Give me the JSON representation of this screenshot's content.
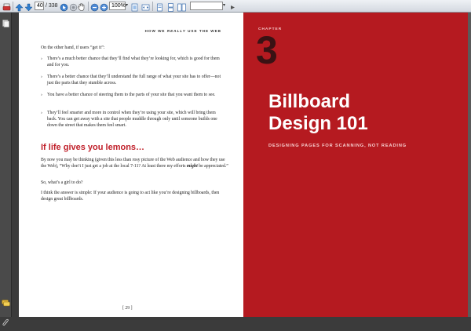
{
  "toolbar": {
    "page_current": "40",
    "page_total": "/ 338",
    "zoom": "100%",
    "search_placeholder": ""
  },
  "left_page": {
    "running_header_pre": "HOW WE",
    "running_header_em": "REALLY",
    "running_header_post": "USE THE WEB",
    "intro": "On the other hand, if users “get it”:",
    "bullets": [
      "There’s a much better chance that they’ll find what they’re looking for, which is good for them and for you.",
      "There’s a better chance that they’ll understand the full range of what your site has to offer—not just the parts that they stumble across.",
      "You have a better chance of steering them to the parts of your site that you want them to see.",
      "They’ll feel smarter and more in control when they’re using your site, which will bring them back. You can get away with a site that people muddle through only until someone builds one down the street that makes them feel smart."
    ],
    "heading": "If life gives you lemons…",
    "para1_pre": "By now you may be thinking (given this less than rosy picture of the Web audience and how they use the Web), “Why don’t I just get a job at the local 7-11? At least there my efforts",
    "para1_em": "might",
    "para1_post": "be appreciated.”",
    "para2": "So, what’s a girl to do?",
    "para3": "I think the answer is simple: If your audience is going to act like you’re designing billboards, then design great billboards.",
    "page_number": "[ 29 ]"
  },
  "right_page": {
    "chapter_label": "CHAPTER",
    "chapter_number": "3",
    "title_line1": "Billboard",
    "title_line2": "Design 101",
    "subtitle": "DESIGNING PAGES FOR SCANNING, NOT READING"
  }
}
